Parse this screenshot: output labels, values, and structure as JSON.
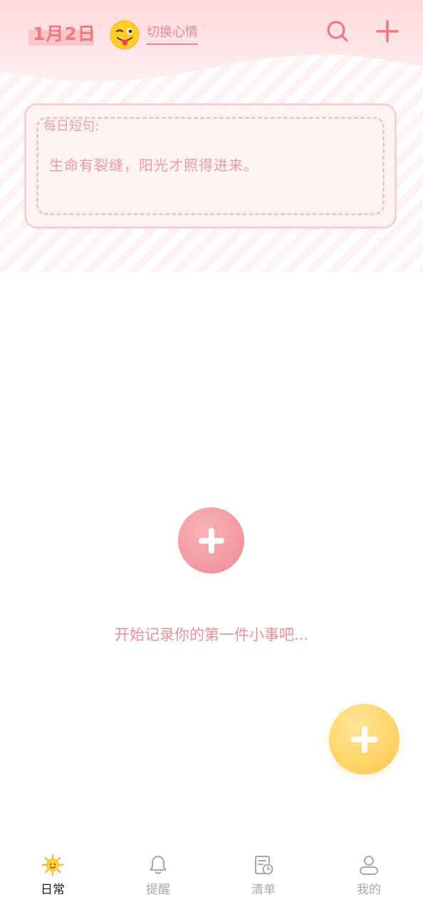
{
  "header": {
    "date": "1月2日",
    "mood_link": "切换心情",
    "icons": [
      "wink-emoji-icon",
      "search-icon",
      "plus-icon"
    ]
  },
  "quote": {
    "title": "每日短句:",
    "text": "生命有裂缝，阳光才照得进来。"
  },
  "empty_state": {
    "hint": "开始记录你的第一件小事吧..."
  },
  "tabbar": {
    "items": [
      {
        "label": "日常",
        "icon": "sun-icon",
        "active": true
      },
      {
        "label": "提醒",
        "icon": "bell-icon",
        "active": false
      },
      {
        "label": "清单",
        "icon": "checklist-clock-icon",
        "active": false
      },
      {
        "label": "我的",
        "icon": "user-icon",
        "active": false
      }
    ]
  },
  "colors": {
    "accent_pink": "#ec7a82",
    "fab_yellow": "#ffd569",
    "inactive_tab": "#a8a8a8",
    "active_tab": "#222222"
  }
}
